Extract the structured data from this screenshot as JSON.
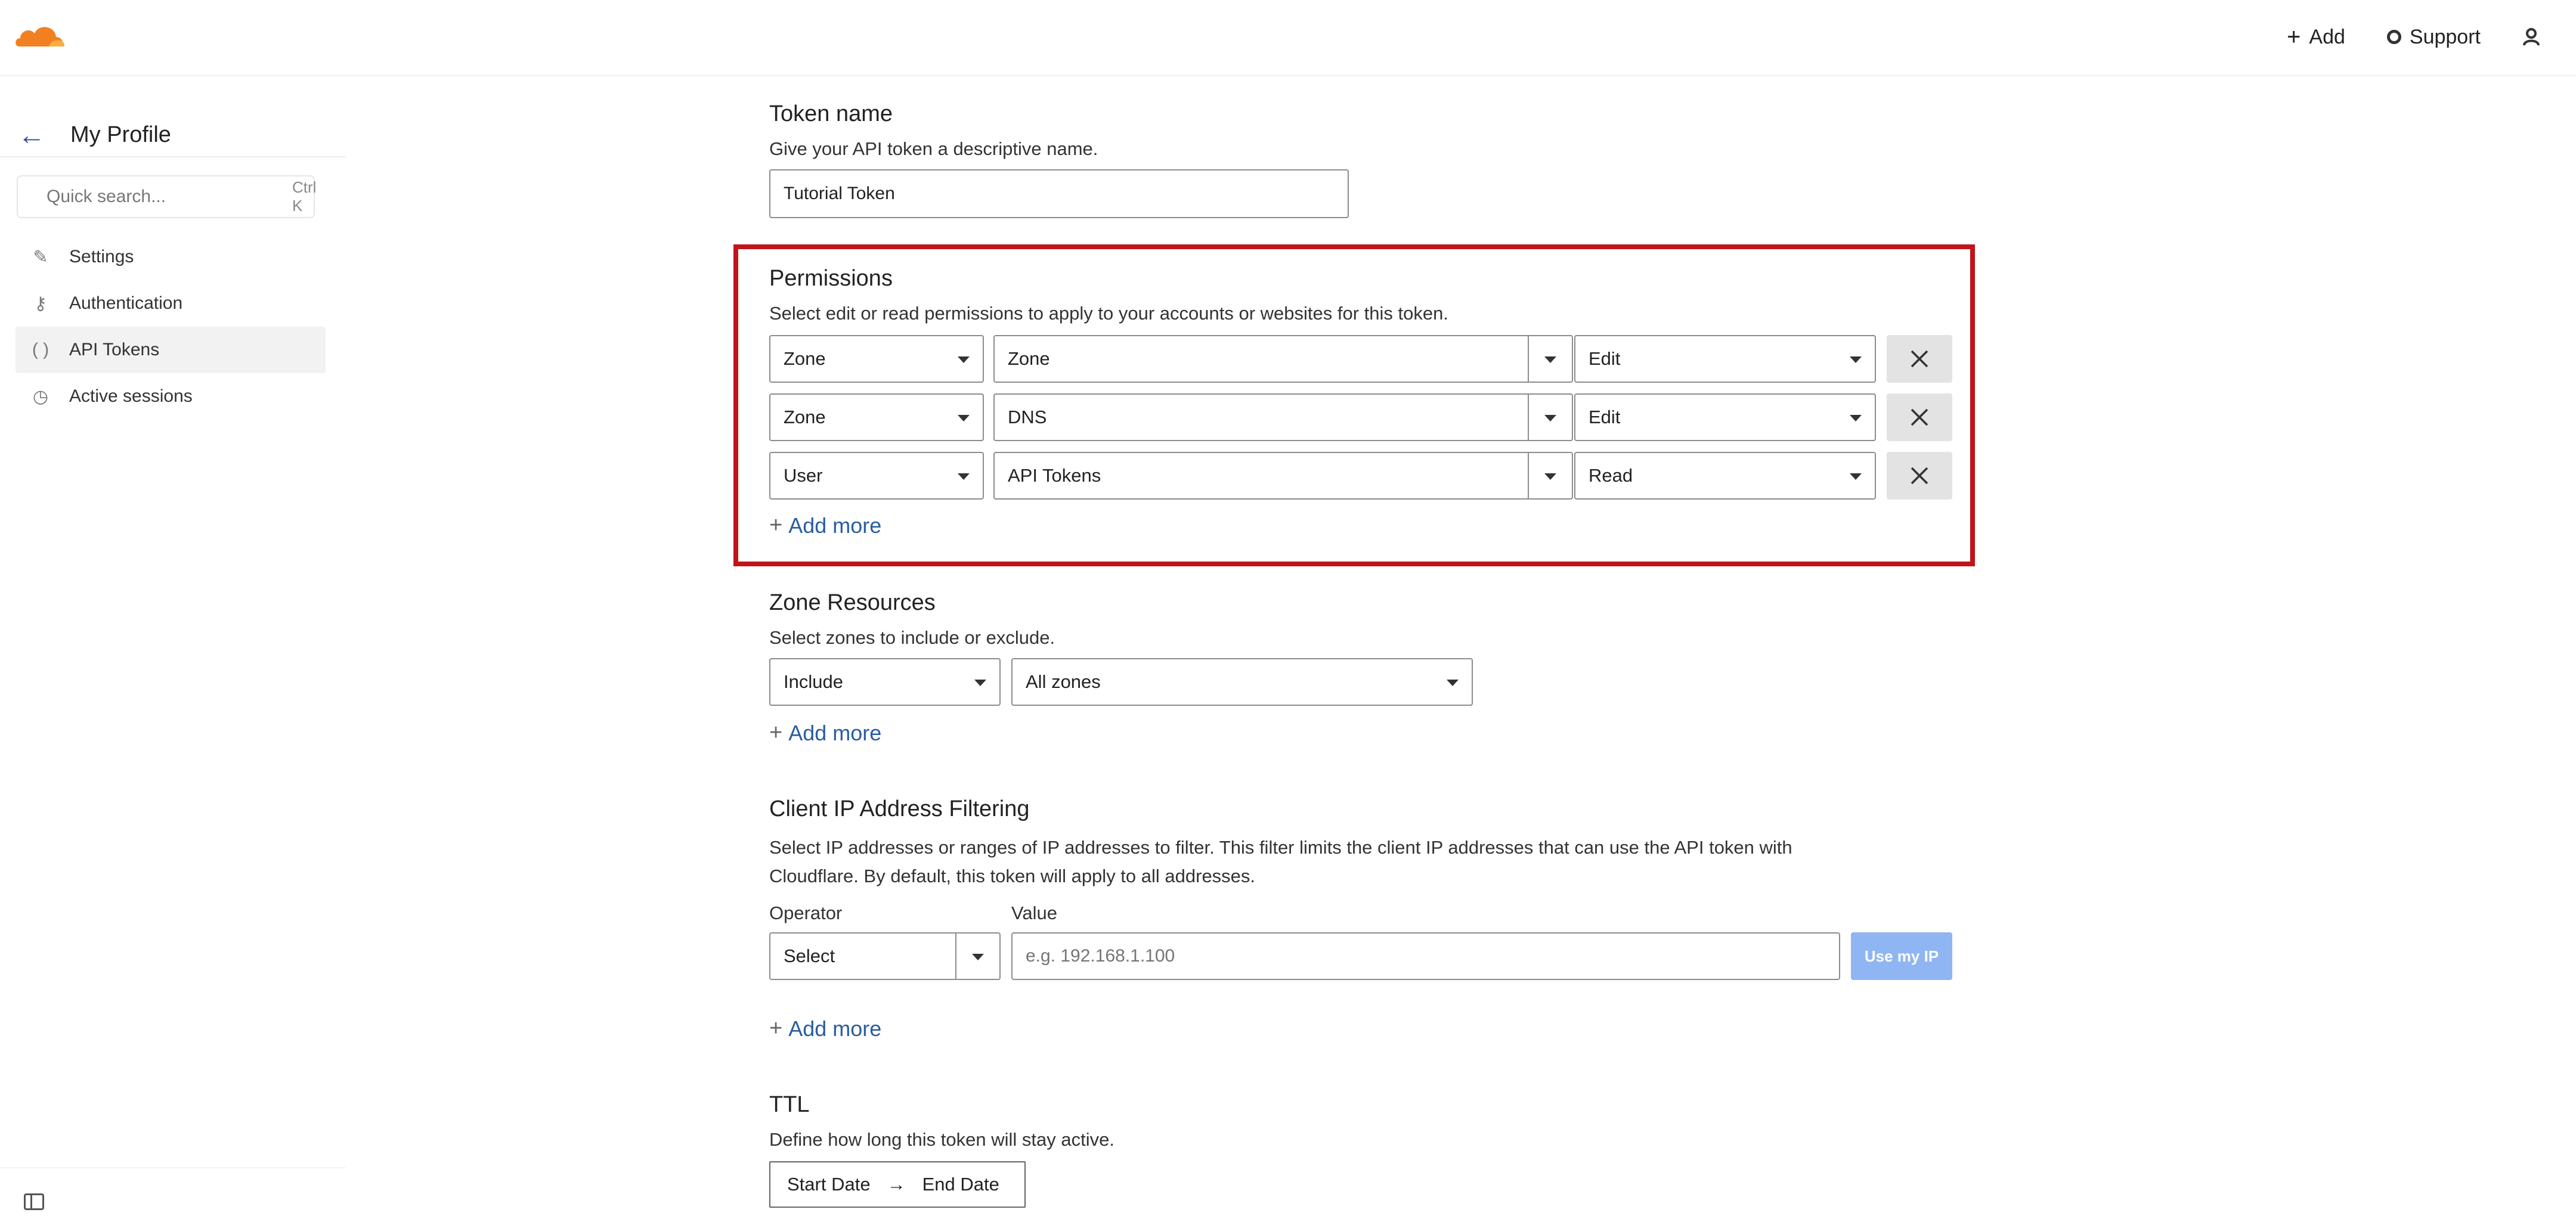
{
  "colors": {
    "accent": "#2a5d9f",
    "highlight": "#c0131a",
    "use_ip_bg": "#8fb6f2",
    "logo": "#f38020"
  },
  "header": {
    "logo_icon": "cloudflare-cloud-icon",
    "add_label": "Add",
    "support_label": "Support",
    "user_icon": "user-icon"
  },
  "sidebar": {
    "title": "My Profile",
    "search_placeholder": "Quick search...",
    "search_shortcut": "Ctrl K",
    "items": [
      {
        "label": "Settings",
        "icon": "pencil-icon"
      },
      {
        "label": "Authentication",
        "icon": "key-icon"
      },
      {
        "label": "API Tokens",
        "icon": "braces-icon",
        "active": true
      },
      {
        "label": "Active sessions",
        "icon": "clock-icon"
      }
    ]
  },
  "token_name": {
    "title": "Token name",
    "desc": "Give your API token a descriptive name.",
    "value": "Tutorial Token"
  },
  "permissions": {
    "title": "Permissions",
    "desc": "Select edit or read permissions to apply to your accounts or websites for this token.",
    "rows": [
      {
        "scope": "Zone",
        "resource": "Zone",
        "access": "Edit"
      },
      {
        "scope": "Zone",
        "resource": "DNS",
        "access": "Edit"
      },
      {
        "scope": "User",
        "resource": "API Tokens",
        "access": "Read"
      }
    ],
    "add_more": "Add more"
  },
  "zone_resources": {
    "title": "Zone Resources",
    "desc": "Select zones to include or exclude.",
    "mode": "Include",
    "target": "All zones",
    "add_more": "Add more"
  },
  "ip_filtering": {
    "title": "Client IP Address Filtering",
    "desc_line1": "Select IP addresses or ranges of IP addresses to filter. This filter limits the client IP addresses that can use the API token with",
    "desc_line2": "Cloudflare. By default, this token will apply to all addresses.",
    "operator_label": "Operator",
    "value_label": "Value",
    "operator_value": "Select",
    "value_placeholder": "e.g. 192.168.1.100",
    "use_ip_label": "Use my IP",
    "add_more": "Add more"
  },
  "ttl": {
    "title": "TTL",
    "desc": "Define how long this token will stay active.",
    "start": "Start Date",
    "end": "End Date"
  }
}
